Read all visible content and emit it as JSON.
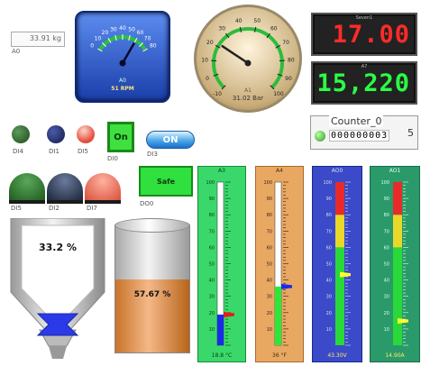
{
  "display_a0": {
    "value": "33.91 kg",
    "tag": "A0"
  },
  "gauge_rpm": {
    "ticks": [
      "0",
      "10",
      "20",
      "30",
      "40",
      "50",
      "60",
      "70",
      "80"
    ],
    "value": 60,
    "readout": "51 RPM",
    "tag": "A0",
    "colors": {
      "face": "#2a55c8",
      "arc": "#27c33a"
    }
  },
  "gauge_bar": {
    "ticks": [
      "-10",
      "0",
      "10",
      "20",
      "30",
      "40",
      "50",
      "60",
      "70",
      "80",
      "90",
      "100"
    ],
    "value": 22,
    "readout": "31.02 Bar",
    "tag": "A1",
    "colors": {
      "face": "#e6d3b0",
      "arc": "#2bbd3a"
    }
  },
  "seg_red": {
    "caption": "Seven1",
    "value": "17.00",
    "color": "#ff2a2a"
  },
  "seg_green": {
    "caption": "A7",
    "value": "15,220",
    "color": "#2aff45"
  },
  "counter": {
    "title": "Counter_0",
    "value": "000000003",
    "suffix": "5"
  },
  "leds": [
    {
      "tag": "DI4",
      "color": "#2e6b2a"
    },
    {
      "tag": "DI1",
      "color": "#1d2a6b"
    },
    {
      "tag": "DI5",
      "color": "#e85a4a"
    }
  ],
  "on_indicator": {
    "label": "On",
    "tag": "DI0"
  },
  "on_button": {
    "label": "ON",
    "tag": "DI3"
  },
  "domes": [
    {
      "tag": "DI5",
      "color": "#2a7a2a"
    },
    {
      "tag": "DI2",
      "color": "#2a3a5a"
    },
    {
      "tag": "DI7",
      "color": "#e05a45"
    }
  ],
  "safe_indicator": {
    "label": "Safe",
    "tag": "DO0"
  },
  "silo": {
    "percent": "33.2 %",
    "level": 0.332
  },
  "tank": {
    "percent": "57.67 %",
    "level": 0.5767
  },
  "bar_a3": {
    "tag": "A3",
    "ticks": [
      "100",
      "90",
      "80",
      "70",
      "60",
      "50",
      "40",
      "30",
      "20",
      "10"
    ],
    "value": 18.8,
    "readout": "18.8 °C"
  },
  "bar_a4": {
    "tag": "A4",
    "ticks": [
      "100",
      "90",
      "80",
      "70",
      "60",
      "50",
      "40",
      "30",
      "20",
      "10"
    ],
    "value": 36,
    "readout": "36 °F"
  },
  "bar_ao0": {
    "tag": "AO0",
    "ticks": [
      "100",
      "90",
      "80",
      "70",
      "60",
      "50",
      "40",
      "30",
      "20",
      "10"
    ],
    "value": 43.3,
    "readout": "43.30V"
  },
  "bar_ao1": {
    "tag": "AO1",
    "ticks": [
      "100",
      "90",
      "80",
      "70",
      "60",
      "50",
      "40",
      "30",
      "20",
      "10"
    ],
    "value": 14.9,
    "readout": "14.90A"
  }
}
